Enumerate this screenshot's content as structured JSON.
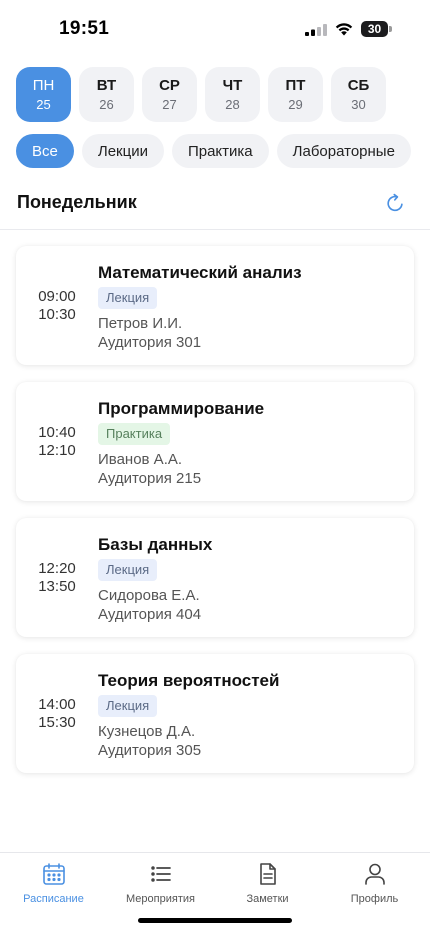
{
  "status": {
    "time": "19:51",
    "battery": "30"
  },
  "days": [
    {
      "name": "ПН",
      "num": "25"
    },
    {
      "name": "ВТ",
      "num": "26"
    },
    {
      "name": "СР",
      "num": "27"
    },
    {
      "name": "ЧТ",
      "num": "28"
    },
    {
      "name": "ПТ",
      "num": "29"
    },
    {
      "name": "СБ",
      "num": "30"
    }
  ],
  "selected_day": "ПН",
  "filters": [
    "Все",
    "Лекции",
    "Практика",
    "Лабораторные"
  ],
  "selected_filter": "Все",
  "section": {
    "title": "Понедельник"
  },
  "classes": [
    {
      "start": "09:00",
      "end": "10:30",
      "title": "Математический анализ",
      "type": "Лекция",
      "teacher": "Петров И.И.",
      "room": "Аудитория 301"
    },
    {
      "start": "10:40",
      "end": "12:10",
      "title": "Программирование",
      "type": "Практика",
      "teacher": "Иванов А.А.",
      "room": "Аудитория 215"
    },
    {
      "start": "12:20",
      "end": "13:50",
      "title": "Базы данных",
      "type": "Лекция",
      "teacher": "Сидорова Е.А.",
      "room": "Аудитория 404"
    },
    {
      "start": "14:00",
      "end": "15:30",
      "title": "Теория вероятностей",
      "type": "Лекция",
      "teacher": "Кузнецов Д.А.",
      "room": "Аудитория 305"
    }
  ],
  "tabs": [
    {
      "label": "Расписание",
      "icon": "calendar-icon"
    },
    {
      "label": "Мероприятия",
      "icon": "list-icon"
    },
    {
      "label": "Заметки",
      "icon": "note-icon"
    },
    {
      "label": "Профиль",
      "icon": "person-icon"
    }
  ],
  "active_tab": "Расписание",
  "colors": {
    "accent": "#4a90e2",
    "lecture_tag_bg": "#e8eefb",
    "practice_tag_bg": "#e4f6e6"
  }
}
